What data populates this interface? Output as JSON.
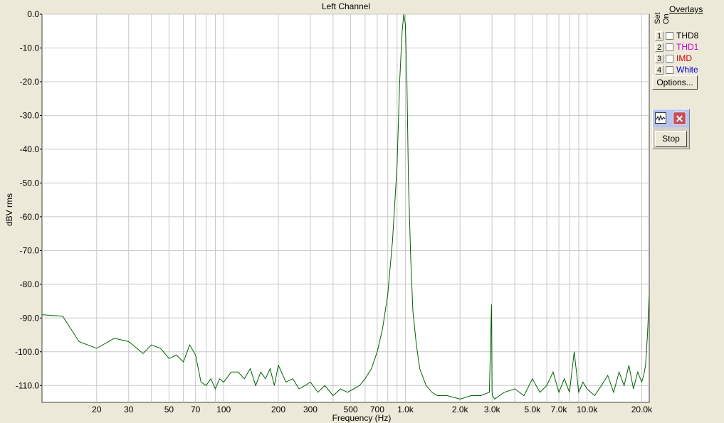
{
  "chart_data": {
    "type": "line",
    "title": "Left Channel",
    "xlabel": "Frequency (Hz)",
    "ylabel": "dBV rms",
    "x_scale": "log",
    "xlim": [
      10,
      22000
    ],
    "ylim": [
      -115,
      0
    ],
    "grid": true,
    "y_ticks": [
      "0.0",
      "-10.0",
      "-20.0",
      "-30.0",
      "-40.0",
      "-50.0",
      "-60.0",
      "-70.0",
      "-80.0",
      "-90.0",
      "-100.0",
      "-110.0"
    ],
    "x_ticks": [
      {
        "value": 20,
        "label": "20"
      },
      {
        "value": 30,
        "label": "30"
      },
      {
        "value": 50,
        "label": "50"
      },
      {
        "value": 70,
        "label": "70"
      },
      {
        "value": 100,
        "label": "100"
      },
      {
        "value": 200,
        "label": "200"
      },
      {
        "value": 300,
        "label": "300"
      },
      {
        "value": 500,
        "label": "500"
      },
      {
        "value": 700,
        "label": "700"
      },
      {
        "value": 1000,
        "label": "1.0k"
      },
      {
        "value": 2000,
        "label": "2.0k"
      },
      {
        "value": 3000,
        "label": "3.0k"
      },
      {
        "value": 5000,
        "label": "5.0k"
      },
      {
        "value": 7000,
        "label": "7.0k"
      },
      {
        "value": 10000,
        "label": "10.0k"
      },
      {
        "value": 20000,
        "label": "20.0k"
      }
    ],
    "series": [
      {
        "color": "#006400",
        "x": [
          10,
          13,
          16,
          20,
          25,
          30,
          36,
          40,
          45,
          50,
          55,
          60,
          65,
          70,
          75,
          80,
          85,
          90,
          95,
          100,
          110,
          120,
          130,
          140,
          150,
          160,
          170,
          180,
          190,
          200,
          220,
          240,
          260,
          280,
          300,
          330,
          360,
          400,
          440,
          480,
          520,
          560,
          600,
          650,
          700,
          750,
          800,
          850,
          900,
          930,
          960,
          980,
          1000,
          1020,
          1040,
          1070,
          1100,
          1150,
          1200,
          1300,
          1400,
          1500,
          1700,
          2000,
          2300,
          2600,
          2900,
          2980,
          3000,
          3020,
          3100,
          3500,
          4000,
          4500,
          5000,
          5500,
          6000,
          6500,
          7000,
          7500,
          8000,
          8500,
          9000,
          9500,
          10000,
          11000,
          12000,
          13000,
          14000,
          15000,
          16000,
          17000,
          18000,
          19000,
          20000,
          20500,
          21000,
          21500,
          22000
        ],
        "y": [
          -89,
          -89.5,
          -97,
          -99,
          -96,
          -97,
          -100.5,
          -98,
          -99,
          -102,
          -101,
          -103,
          -98,
          -101,
          -109,
          -110,
          -108,
          -111,
          -108,
          -109,
          -106,
          -106,
          -108,
          -105,
          -110,
          -106,
          -108,
          -105,
          -110,
          -104,
          -109,
          -108,
          -111,
          -110,
          -109,
          -112,
          -110,
          -113,
          -111,
          -112,
          -111,
          -110,
          -108,
          -105,
          -100,
          -93,
          -83,
          -67,
          -45,
          -20,
          -5,
          0,
          -3,
          -20,
          -50,
          -72,
          -88,
          -98,
          -105,
          -110,
          -112,
          -113,
          -113,
          -114,
          -113,
          -113,
          -112,
          -86,
          -112,
          -113,
          -114,
          -112,
          -111,
          -113,
          -108,
          -112,
          -110,
          -106,
          -112,
          -108,
          -112,
          -100,
          -112,
          -109,
          -111,
          -113,
          -110,
          -107,
          -112,
          -106,
          -110,
          -104,
          -111,
          -106,
          -109,
          -107,
          -104,
          -95,
          -83
        ]
      }
    ]
  },
  "overlays": {
    "title": "Overlays",
    "set_label": "Set",
    "on_label": "On",
    "items": [
      {
        "num": "1",
        "label": "THD8",
        "color": "#000000"
      },
      {
        "num": "2",
        "label": "THD1",
        "color": "#cc00cc"
      },
      {
        "num": "3",
        "label": "IMD",
        "color": "#cc0000"
      },
      {
        "num": "4",
        "label": "White",
        "color": "#0000cc"
      }
    ],
    "options_label": "Options..."
  },
  "stop_widget": {
    "stop_label": "Stop",
    "close_glyph": "✕"
  }
}
